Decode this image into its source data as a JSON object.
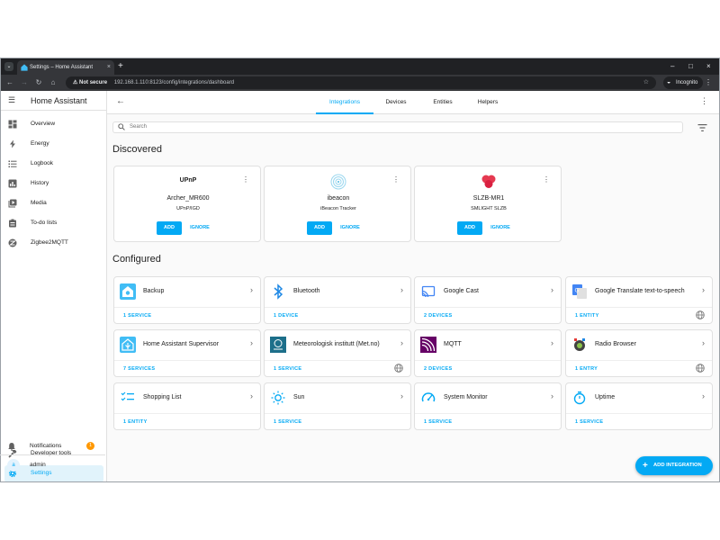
{
  "browser": {
    "tab_title": "Settings – Home Assistant",
    "tab_close": "×",
    "new_tab": "+",
    "window_controls": [
      "–",
      "□",
      "×"
    ],
    "security_label": "Not secure",
    "url": "192.168.1.110:8123/config/integrations/dashboard",
    "incognito_label": "Incognito"
  },
  "sidebar": {
    "title": "Home Assistant",
    "items": [
      {
        "label": "Overview",
        "icon": "overview-icon"
      },
      {
        "label": "Energy",
        "icon": "energy-icon"
      },
      {
        "label": "Logbook",
        "icon": "logbook-icon"
      },
      {
        "label": "History",
        "icon": "history-icon"
      },
      {
        "label": "Media",
        "icon": "media-icon"
      },
      {
        "label": "To-do lists",
        "icon": "todo-icon"
      },
      {
        "label": "Zigbee2MQTT",
        "icon": "zigbee-icon"
      }
    ],
    "bottom": [
      {
        "label": "Developer tools",
        "icon": "hammer-icon"
      },
      {
        "label": "Settings",
        "icon": "gear-icon"
      }
    ],
    "notifications": {
      "label": "Notifications",
      "badge": "1"
    },
    "user": {
      "label": "admin",
      "initial": "a"
    }
  },
  "header": {
    "tabs": [
      {
        "label": "Integrations"
      },
      {
        "label": "Devices"
      },
      {
        "label": "Entities"
      },
      {
        "label": "Helpers"
      }
    ]
  },
  "search": {
    "placeholder": "Search"
  },
  "discovered": {
    "title": "Discovered",
    "cards": [
      {
        "logo_text": "UPnP",
        "name": "Archer_MR600",
        "subtitle": "UPnP/IGD",
        "add_label": "ADD",
        "ignore_label": "IGNORE"
      },
      {
        "logo_text": "",
        "name": "ibeacon",
        "subtitle": "iBeacon Tracker",
        "add_label": "ADD",
        "ignore_label": "IGNORE"
      },
      {
        "logo_text": "",
        "name": "SLZB-MR1",
        "subtitle": "SMLIGHT SLZB",
        "add_label": "ADD",
        "ignore_label": "IGNORE"
      }
    ]
  },
  "configured": {
    "title": "Configured",
    "cards": [
      {
        "name": "Backup",
        "count": "1 SERVICE",
        "icon": "backup-icon",
        "cloud": false
      },
      {
        "name": "Bluetooth",
        "count": "1 DEVICE",
        "icon": "bluetooth-icon",
        "cloud": false
      },
      {
        "name": "Google Cast",
        "count": "2 DEVICES",
        "icon": "cast-icon",
        "cloud": false
      },
      {
        "name": "Google Translate text-to-speech",
        "count": "1 ENTITY",
        "icon": "translate-icon",
        "cloud": true
      },
      {
        "name": "Home Assistant Supervisor",
        "count": "7 SERVICES",
        "icon": "supervisor-icon",
        "cloud": false
      },
      {
        "name": "Meteorologisk institutt (Met.no)",
        "count": "1 SERVICE",
        "icon": "weather-icon",
        "cloud": true
      },
      {
        "name": "MQTT",
        "count": "2 DEVICES",
        "icon": "mqtt-icon",
        "cloud": false
      },
      {
        "name": "Radio Browser",
        "count": "1 ENTRY",
        "icon": "radio-icon",
        "cloud": true
      },
      {
        "name": "Shopping List",
        "count": "1 ENTITY",
        "icon": "list-icon",
        "cloud": false
      },
      {
        "name": "Sun",
        "count": "1 SERVICE",
        "icon": "sun-icon",
        "cloud": false
      },
      {
        "name": "System Monitor",
        "count": "1 SERVICE",
        "icon": "gauge-icon",
        "cloud": false
      },
      {
        "name": "Uptime",
        "count": "1 SERVICE",
        "icon": "timer-icon",
        "cloud": false
      }
    ]
  },
  "fab": {
    "label": "ADD INTEGRATION"
  },
  "colors": {
    "accent": "#03a9f4",
    "badge": "#ff9800"
  }
}
